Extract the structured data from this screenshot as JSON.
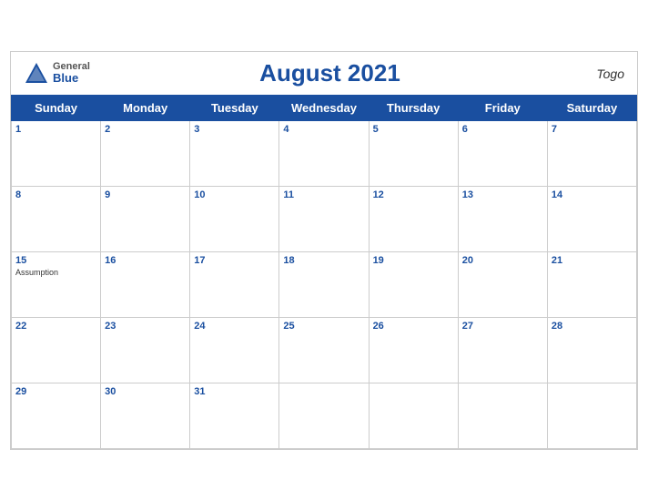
{
  "header": {
    "logo_general": "General",
    "logo_blue": "Blue",
    "title": "August 2021",
    "country": "Togo"
  },
  "weekdays": [
    "Sunday",
    "Monday",
    "Tuesday",
    "Wednesday",
    "Thursday",
    "Friday",
    "Saturday"
  ],
  "weeks": [
    [
      {
        "day": "1",
        "event": ""
      },
      {
        "day": "2",
        "event": ""
      },
      {
        "day": "3",
        "event": ""
      },
      {
        "day": "4",
        "event": ""
      },
      {
        "day": "5",
        "event": ""
      },
      {
        "day": "6",
        "event": ""
      },
      {
        "day": "7",
        "event": ""
      }
    ],
    [
      {
        "day": "8",
        "event": ""
      },
      {
        "day": "9",
        "event": ""
      },
      {
        "day": "10",
        "event": ""
      },
      {
        "day": "11",
        "event": ""
      },
      {
        "day": "12",
        "event": ""
      },
      {
        "day": "13",
        "event": ""
      },
      {
        "day": "14",
        "event": ""
      }
    ],
    [
      {
        "day": "15",
        "event": "Assumption"
      },
      {
        "day": "16",
        "event": ""
      },
      {
        "day": "17",
        "event": ""
      },
      {
        "day": "18",
        "event": ""
      },
      {
        "day": "19",
        "event": ""
      },
      {
        "day": "20",
        "event": ""
      },
      {
        "day": "21",
        "event": ""
      }
    ],
    [
      {
        "day": "22",
        "event": ""
      },
      {
        "day": "23",
        "event": ""
      },
      {
        "day": "24",
        "event": ""
      },
      {
        "day": "25",
        "event": ""
      },
      {
        "day": "26",
        "event": ""
      },
      {
        "day": "27",
        "event": ""
      },
      {
        "day": "28",
        "event": ""
      }
    ],
    [
      {
        "day": "29",
        "event": ""
      },
      {
        "day": "30",
        "event": ""
      },
      {
        "day": "31",
        "event": ""
      },
      {
        "day": "",
        "event": ""
      },
      {
        "day": "",
        "event": ""
      },
      {
        "day": "",
        "event": ""
      },
      {
        "day": "",
        "event": ""
      }
    ]
  ]
}
